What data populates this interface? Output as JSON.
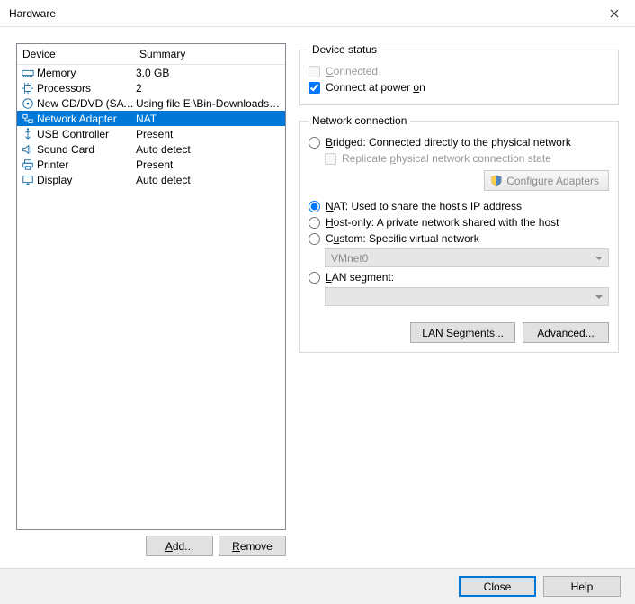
{
  "window": {
    "title": "Hardware"
  },
  "device_table": {
    "headers": {
      "device": "Device",
      "summary": "Summary"
    },
    "rows": [
      {
        "icon": "memory-icon",
        "name": "Memory",
        "summary": "3.0 GB",
        "selected": false
      },
      {
        "icon": "cpu-icon",
        "name": "Processors",
        "summary": "2",
        "selected": false
      },
      {
        "icon": "disc-icon",
        "name": "New CD/DVD (SATA)",
        "summary": "Using file E:\\Bin-Downloads\\li...",
        "selected": false
      },
      {
        "icon": "network-icon",
        "name": "Network Adapter",
        "summary": "NAT",
        "selected": true
      },
      {
        "icon": "usb-icon",
        "name": "USB Controller",
        "summary": "Present",
        "selected": false
      },
      {
        "icon": "sound-icon",
        "name": "Sound Card",
        "summary": "Auto detect",
        "selected": false
      },
      {
        "icon": "printer-icon",
        "name": "Printer",
        "summary": "Present",
        "selected": false
      },
      {
        "icon": "display-icon",
        "name": "Display",
        "summary": "Auto detect",
        "selected": false
      }
    ]
  },
  "left_buttons": {
    "add": "Add...",
    "remove": "Remove"
  },
  "device_status": {
    "legend": "Device status",
    "connected": {
      "label": "Connected",
      "accel": "C",
      "checked": false,
      "enabled": false
    },
    "connect_on_poweron": {
      "label": "Connect at power on",
      "accel": "o",
      "checked": true
    }
  },
  "network_connection": {
    "legend": "Network connection",
    "selected": "nat",
    "bridged": {
      "label": "Bridged: Connected directly to the physical network",
      "accel": "B"
    },
    "replicate": {
      "label": "Replicate physical network connection state",
      "accel": "p",
      "checked": false,
      "enabled": false
    },
    "configure_adapters": {
      "label": "Configure Adapters",
      "enabled": false
    },
    "nat": {
      "label": "NAT: Used to share the host's IP address",
      "accel": "N"
    },
    "hostonly": {
      "label": "Host-only: A private network shared with the host",
      "accel": "H"
    },
    "custom": {
      "label": "Custom: Specific virtual network",
      "accel": "u"
    },
    "custom_dropdown": {
      "value": "VMnet0",
      "enabled": false
    },
    "lanseg": {
      "label": "LAN segment:",
      "accel": "L"
    },
    "lanseg_dropdown": {
      "value": "",
      "enabled": false
    },
    "buttons": {
      "lan_segments": "LAN Segments...",
      "advanced": "Advanced..."
    }
  },
  "footer": {
    "close": "Close",
    "help": "Help"
  }
}
